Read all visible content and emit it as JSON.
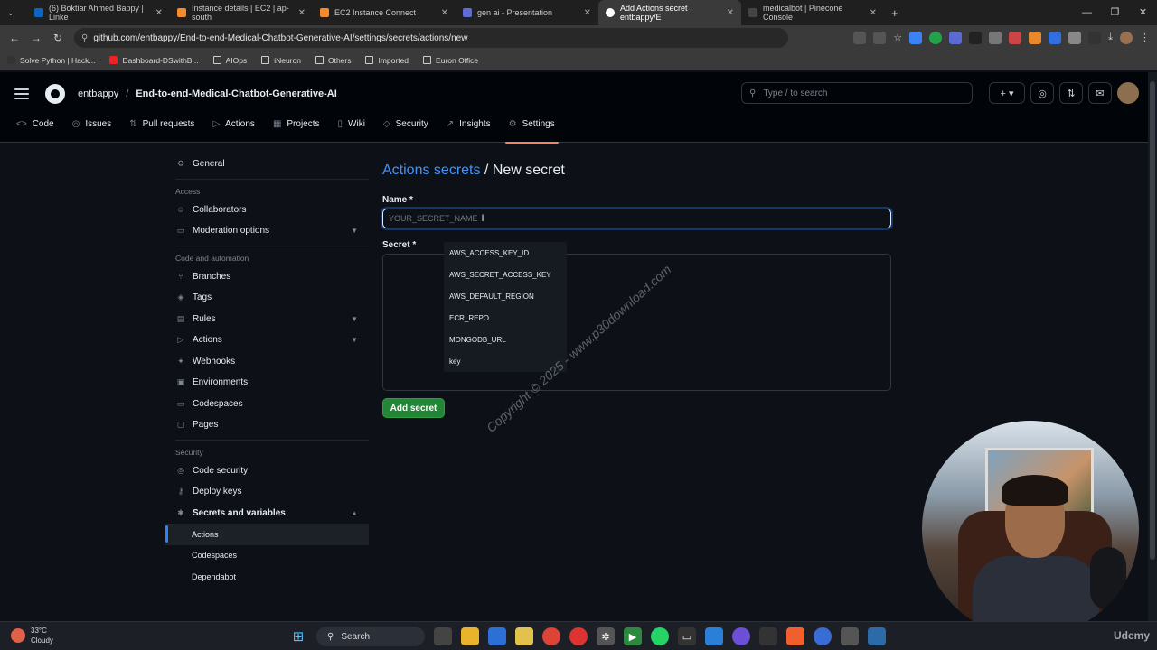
{
  "browser": {
    "tabs": [
      {
        "label": "(6) Boktiar Ahmed Bappy | Linke",
        "color": "#0a66c2",
        "active": false
      },
      {
        "label": "Instance details | EC2 | ap-south",
        "color": "#f28b30",
        "active": false
      },
      {
        "label": "EC2 Instance Connect",
        "color": "#f28b30",
        "active": false
      },
      {
        "label": "gen ai - Presentation",
        "color": "#5f6bd6",
        "active": false
      },
      {
        "label": "Add Actions secret · entbappy/E",
        "color": "#ffffff",
        "active": true
      },
      {
        "label": "medicalbot | Pinecone Console",
        "color": "#222222",
        "active": false
      }
    ],
    "url": "github.com/entbappy/End-to-end-Medical-Chatbot-Generative-AI/settings/secrets/actions/new",
    "bookmarks": [
      "Solve Python | Hack...",
      "Dashboard-DSwithB...",
      "AIOps",
      "iNeuron",
      "Others",
      "Imported",
      "Euron Office"
    ]
  },
  "github": {
    "owner": "entbappy",
    "repo": "End-to-end-Medical-Chatbot-Generative-AI",
    "search_placeholder": "Type / to search",
    "repo_nav": [
      {
        "label": "Code",
        "icon": "<>"
      },
      {
        "label": "Issues",
        "icon": "◎"
      },
      {
        "label": "Pull requests",
        "icon": "⇅"
      },
      {
        "label": "Actions",
        "icon": "▷"
      },
      {
        "label": "Projects",
        "icon": "▦"
      },
      {
        "label": "Wiki",
        "icon": "▯"
      },
      {
        "label": "Security",
        "icon": "◇"
      },
      {
        "label": "Insights",
        "icon": "↗"
      },
      {
        "label": "Settings",
        "icon": "⚙"
      }
    ]
  },
  "sidebar": {
    "general": "General",
    "access_heading": "Access",
    "access": [
      "Collaborators",
      "Moderation options"
    ],
    "code_heading": "Code and automation",
    "code": [
      "Branches",
      "Tags",
      "Rules",
      "Actions",
      "Webhooks",
      "Environments",
      "Codespaces",
      "Pages"
    ],
    "security_heading": "Security",
    "security": [
      "Code security",
      "Deploy keys",
      "Secrets and variables"
    ],
    "secrets_sub": [
      "Actions",
      "Codespaces",
      "Dependabot"
    ]
  },
  "main": {
    "title_link": "Actions secrets",
    "title_rest": " / New secret",
    "name_label": "Name *",
    "name_placeholder": "YOUR_SECRET_NAME",
    "secret_label": "Secret *",
    "add_button": "Add secret",
    "autocomplete": [
      "AWS_ACCESS_KEY_ID",
      "AWS_SECRET_ACCESS_KEY",
      "AWS_DEFAULT_REGION",
      "ECR_REPO",
      "MONGODB_URL",
      "key"
    ]
  },
  "watermark": "Copyright © 2025 - www.p30download.com",
  "taskbar": {
    "temp": "33°C",
    "condition": "Cloudy",
    "search": "Search",
    "brand": "Udemy"
  }
}
